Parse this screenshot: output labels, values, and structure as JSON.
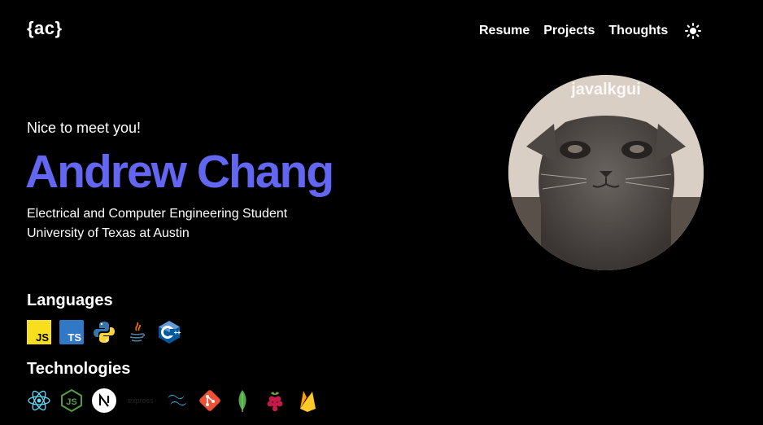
{
  "header": {
    "logo": "{ac}",
    "nav": [
      {
        "label": "Resume"
      },
      {
        "label": "Projects"
      },
      {
        "label": "Thoughts"
      }
    ],
    "theme_icon": "sun-icon"
  },
  "hero": {
    "greeting": "Nice to meet you!",
    "name": "Andrew Chang",
    "subtitle_line1": "Electrical and Computer Engineering Student",
    "subtitle_line2": "University of Texas at Austin",
    "avatar_caption": "javalkgui"
  },
  "languages": {
    "title": "Languages",
    "icons": [
      "javascript-icon",
      "typescript-icon",
      "python-icon",
      "java-icon",
      "cplusplus-icon"
    ]
  },
  "technologies": {
    "title": "Technologies",
    "icons": [
      "react-icon",
      "nodejs-icon",
      "nextjs-icon",
      "express-icon",
      "tailwind-icon",
      "git-icon",
      "mongodb-icon",
      "raspberrypi-icon",
      "firebase-icon"
    ],
    "express_label": "express"
  },
  "colors": {
    "accent": "#6366f1",
    "background": "#000000"
  }
}
